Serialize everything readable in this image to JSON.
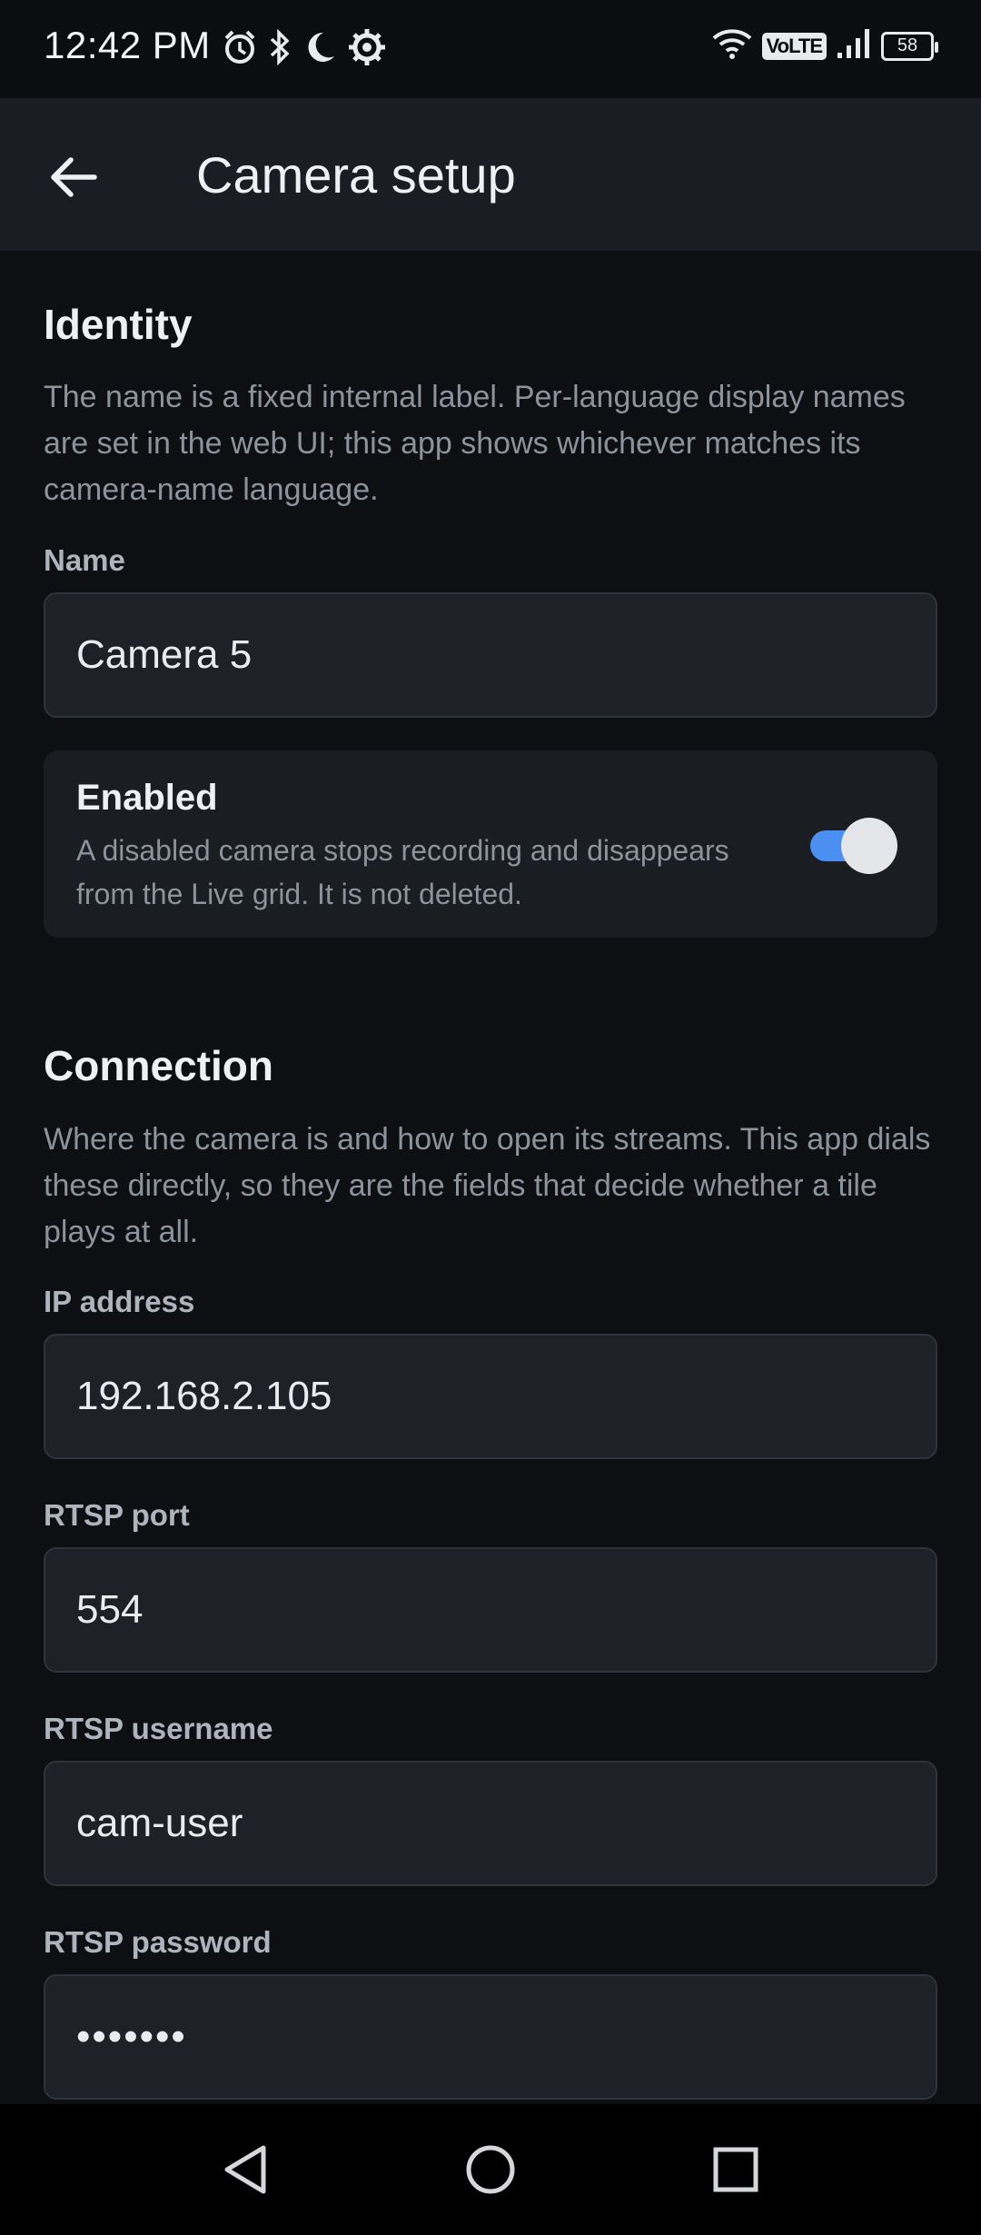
{
  "status_bar": {
    "time": "12:42 PM",
    "left_icons": [
      "alarm-icon",
      "bluetooth-icon",
      "moon-icon",
      "settings-gear-icon"
    ],
    "right_icons": [
      "wifi-icon",
      "volte-icon",
      "signal-icon",
      "battery-icon"
    ],
    "volte_label": "VoLTE",
    "battery_level": "58"
  },
  "app_bar": {
    "title": "Camera setup",
    "back_icon": "arrow-left-icon"
  },
  "identity": {
    "title": "Identity",
    "description": "The name is a fixed internal label. Per-language display names are set in the web UI; this app shows whichever matches its camera-name language.",
    "name_label": "Name",
    "name_value": "Camera 5",
    "enabled_title": "Enabled",
    "enabled_description": "A disabled camera stops recording and disappears from the Live grid. It is not deleted.",
    "enabled_on": true
  },
  "connection": {
    "title": "Connection",
    "description": "Where the camera is and how to open its streams. This app dials these directly, so they are the fields that decide whether a tile plays at all.",
    "ip_label": "IP address",
    "ip_value": "192.168.2.105",
    "port_label": "RTSP port",
    "port_value": "554",
    "username_label": "RTSP username",
    "username_value": "cam-user",
    "password_label": "RTSP password",
    "password_value": "•••••••"
  },
  "colors": {
    "accent": "#4c8ff2",
    "background": "#0e0f12",
    "app_bar": "#1a1d23"
  },
  "nav_bar": {
    "icons": [
      "back-triangle-icon",
      "home-circle-icon",
      "recents-square-icon"
    ]
  }
}
